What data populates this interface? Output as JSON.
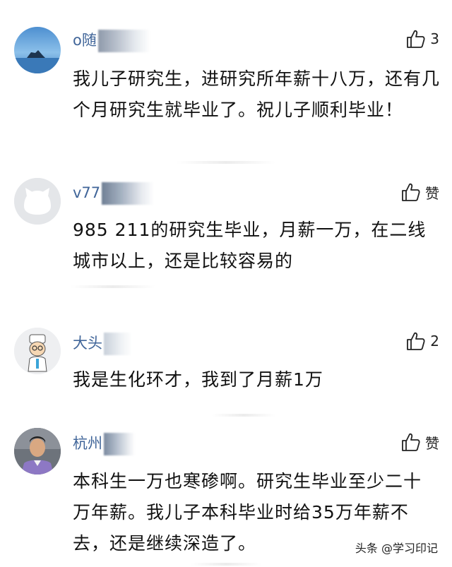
{
  "comments": [
    {
      "username": "o随",
      "likes": "3",
      "text": "我儿子研究生，进研究所年薪十八万，还有几个月研究生就毕业了。祝儿子顺利毕业！"
    },
    {
      "username": "v77",
      "likes": "赞",
      "text": "985 211的研究生毕业，月薪一万，在二线城市以上，还是比较容易的"
    },
    {
      "username": "大头",
      "likes": "2",
      "text": "我是生化环才，我到了月薪1万"
    },
    {
      "username": "杭州",
      "likes": "赞",
      "text": "本科生一万也寒碜啊。研究生毕业至少二十万年薪。我儿子本科毕业时给35万年薪不去，还是继续深造了。"
    }
  ],
  "watermark": "头条 @学习印记",
  "icons": {
    "like": "thumbs-up-icon"
  }
}
